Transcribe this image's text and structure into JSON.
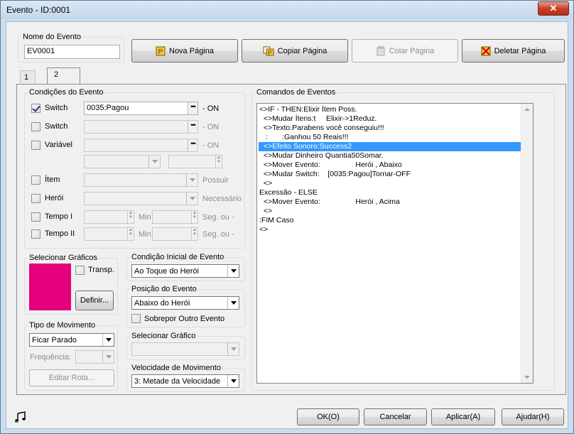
{
  "window": {
    "title": "Evento - ID:0001",
    "close_label": "✕"
  },
  "nome_evento": {
    "legend": "Nome do Evento",
    "value": "EV0001"
  },
  "toolbar": {
    "nova": "Nova Página",
    "copiar": "Copiar Página",
    "colar": "Colar Página",
    "deletar": "Deletar Página"
  },
  "tabs": [
    {
      "label": "1"
    },
    {
      "label": "2"
    }
  ],
  "condicoes": {
    "legend": "Condições do Evento",
    "switch1": {
      "label": "Switch",
      "value": "0035:Pagou",
      "suffix": "- ON",
      "checked": true
    },
    "switch2": {
      "label": "Switch",
      "value": "",
      "suffix": "- ON"
    },
    "variavel": {
      "label": "Variável",
      "value": "",
      "suffix": "- ON"
    },
    "item": {
      "label": "Ítem",
      "suffix": "Possuir"
    },
    "heroi": {
      "label": "Herói",
      "suffix": "Necessário"
    },
    "tempo1": {
      "label": "Tempo I",
      "min": "Min",
      "seg": "Seg. ou -"
    },
    "tempo2": {
      "label": "Tempo II",
      "min": "Min",
      "seg": "Seg. ou -"
    }
  },
  "graficos": {
    "legend": "Selecionar Gráficos",
    "transp": "Transp.",
    "definir": "Definir...",
    "color": "#e6007e"
  },
  "movimento": {
    "legend": "Tipo de Movimento",
    "value": "Ficar Parado",
    "frequencia": "Frequência:",
    "editar": "Editar Rota..."
  },
  "condicao_inicial": {
    "legend": "Condição Inicial de Evento",
    "value": "Ao Toque do Herói"
  },
  "posicao": {
    "legend": "Posição do Evento",
    "value": "Abaixo do Herói",
    "sobrepor": "Sobrepor Outro Evento"
  },
  "sel_grafico": {
    "legend": "Selecionar Gráfico"
  },
  "velocidade": {
    "legend": "Velocidade de Movimento",
    "value": "3: Metade da Velocidade"
  },
  "comandos": {
    "legend": "Comandos de Eventos",
    "rows": [
      "<>IF - THEN:Elixir Ítem Poss.",
      "  <>Mudar Ítens:t     Elixir->1Reduz.",
      "  <>Texto:Parabens você conseguiu!!!",
      "   :       :Ganhou 50 Reais!!!",
      "  <>Efeito Sonoro:Success2",
      "  <>Mudar Dinheiro Quantia50Somar.",
      "  <>Mover Evento:                 Herói , Abaixo",
      "  <>Mudar Switch:    [0035:Pagou]Tornar-OFF",
      "  <>",
      "Excessão - ELSE",
      "  <>Mover Evento:                 Herói , Acima",
      "  <>",
      ":FIM Caso",
      "<>"
    ],
    "selected_index": 4
  },
  "footer": {
    "ok": "OK(O)",
    "cancelar": "Cancelar",
    "aplicar": "Aplicar(A)",
    "ajudar": "Ajudar(H)"
  }
}
